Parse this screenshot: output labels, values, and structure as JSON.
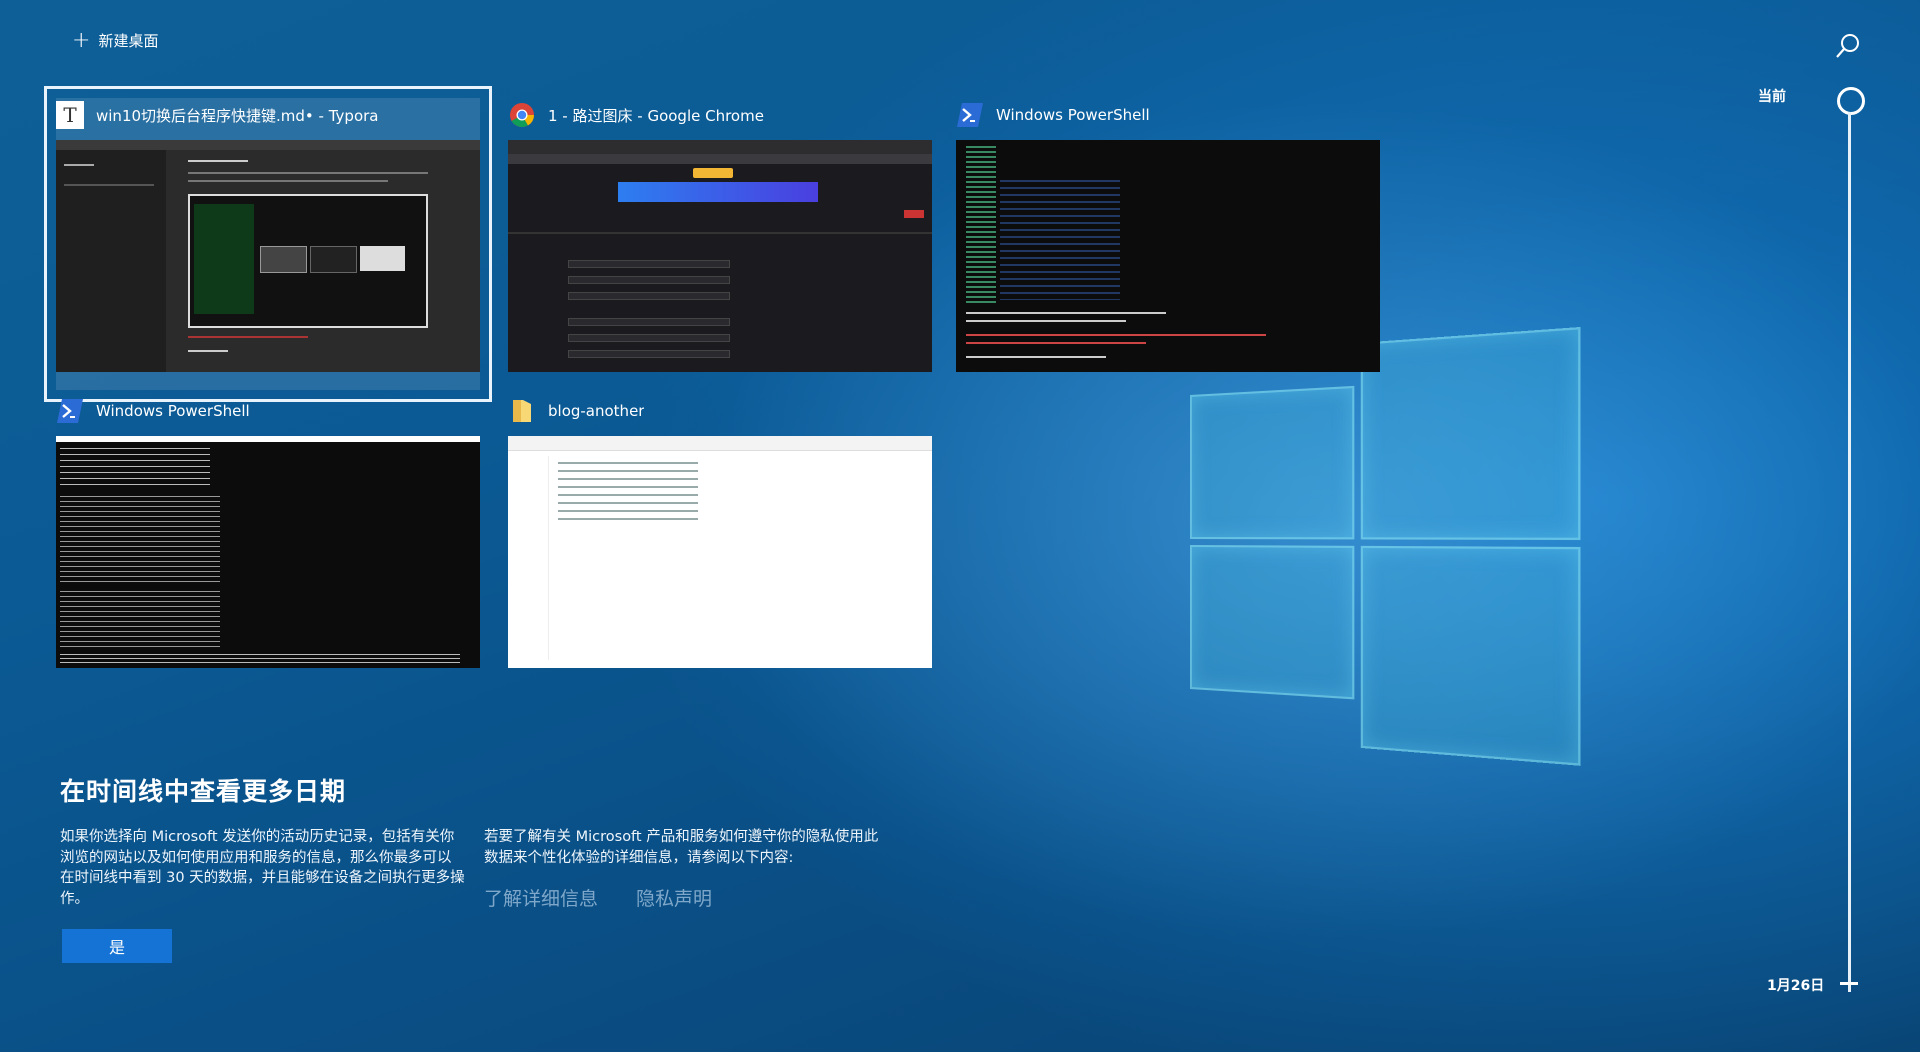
{
  "topbar": {
    "new_desktop_label": "新建桌面"
  },
  "timeline": {
    "current_label": "当前",
    "date_label": "1月26日"
  },
  "windows": [
    {
      "title": "win10切换后台程序快捷键.md• - Typora",
      "app": "typora-icon",
      "selected": true
    },
    {
      "title": "1 - 路过图床 - Google Chrome",
      "app": "chrome-icon"
    },
    {
      "title": "Windows PowerShell",
      "app": "powershell-icon"
    },
    {
      "title": "Windows PowerShell",
      "app": "powershell-icon"
    },
    {
      "title": "blog-another",
      "app": "folder-icon"
    }
  ],
  "typora_icon_letter": "T",
  "info": {
    "heading": "在时间线中查看更多日期",
    "paragraph1": "如果你选择向 Microsoft 发送你的活动历史记录，包括有关你浏览的网站以及如何使用应用和服务的信息，那么你最多可以在时间线中看到 30 天的数据，并且能够在设备之间执行更多操作。",
    "paragraph2": "若要了解有关 Microsoft 产品和服务如何遵守你的隐私使用此数据来个性化体验的详细信息，请参阅以下内容:",
    "link_learn_more": "了解详细信息",
    "link_privacy": "隐私声明",
    "yes_button": "是"
  },
  "colors": {
    "accent": "#1473d4",
    "link": "#7ea7c9",
    "background": "#0b5a95"
  }
}
